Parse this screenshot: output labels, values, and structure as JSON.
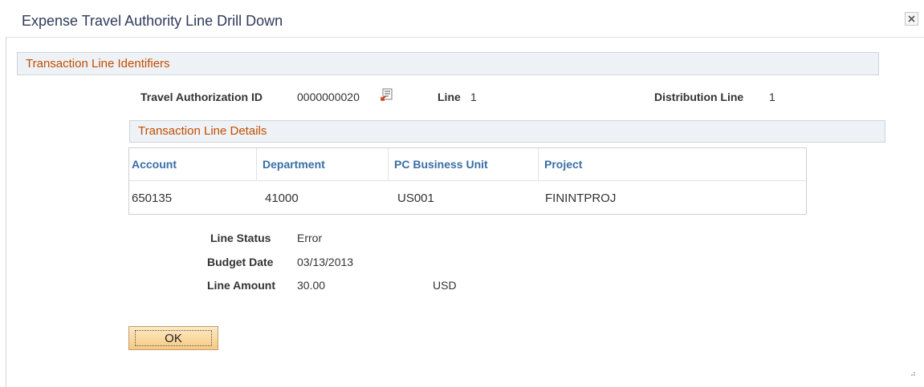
{
  "dialog": {
    "title": "Expense Travel Authority Line Drill Down",
    "close_icon": "close-icon"
  },
  "identifiers": {
    "header": "Transaction Line Identifiers",
    "travel_auth_label": "Travel Authorization ID",
    "travel_auth_value": "0000000020",
    "lookup_icon": "document-lookup-icon",
    "line_label": "Line",
    "line_value": "1",
    "distribution_line_label": "Distribution Line",
    "distribution_line_value": "1"
  },
  "details": {
    "header": "Transaction Line Details",
    "columns": [
      "Account",
      "Department",
      "PC Business Unit",
      "Project"
    ],
    "rows": [
      [
        "650135",
        "41000",
        "US001",
        "FININTPROJ"
      ]
    ]
  },
  "summary": {
    "line_status_label": "Line Status",
    "line_status_value": "Error",
    "budget_date_label": "Budget Date",
    "budget_date_value": "03/13/2013",
    "line_amount_label": "Line Amount",
    "line_amount_value": "30.00",
    "currency": "USD"
  },
  "buttons": {
    "ok_label": "OK"
  },
  "colors": {
    "group_header_text": "#c24e00",
    "column_header_text": "#3a6ea5",
    "button_fill": "#f6c983"
  }
}
